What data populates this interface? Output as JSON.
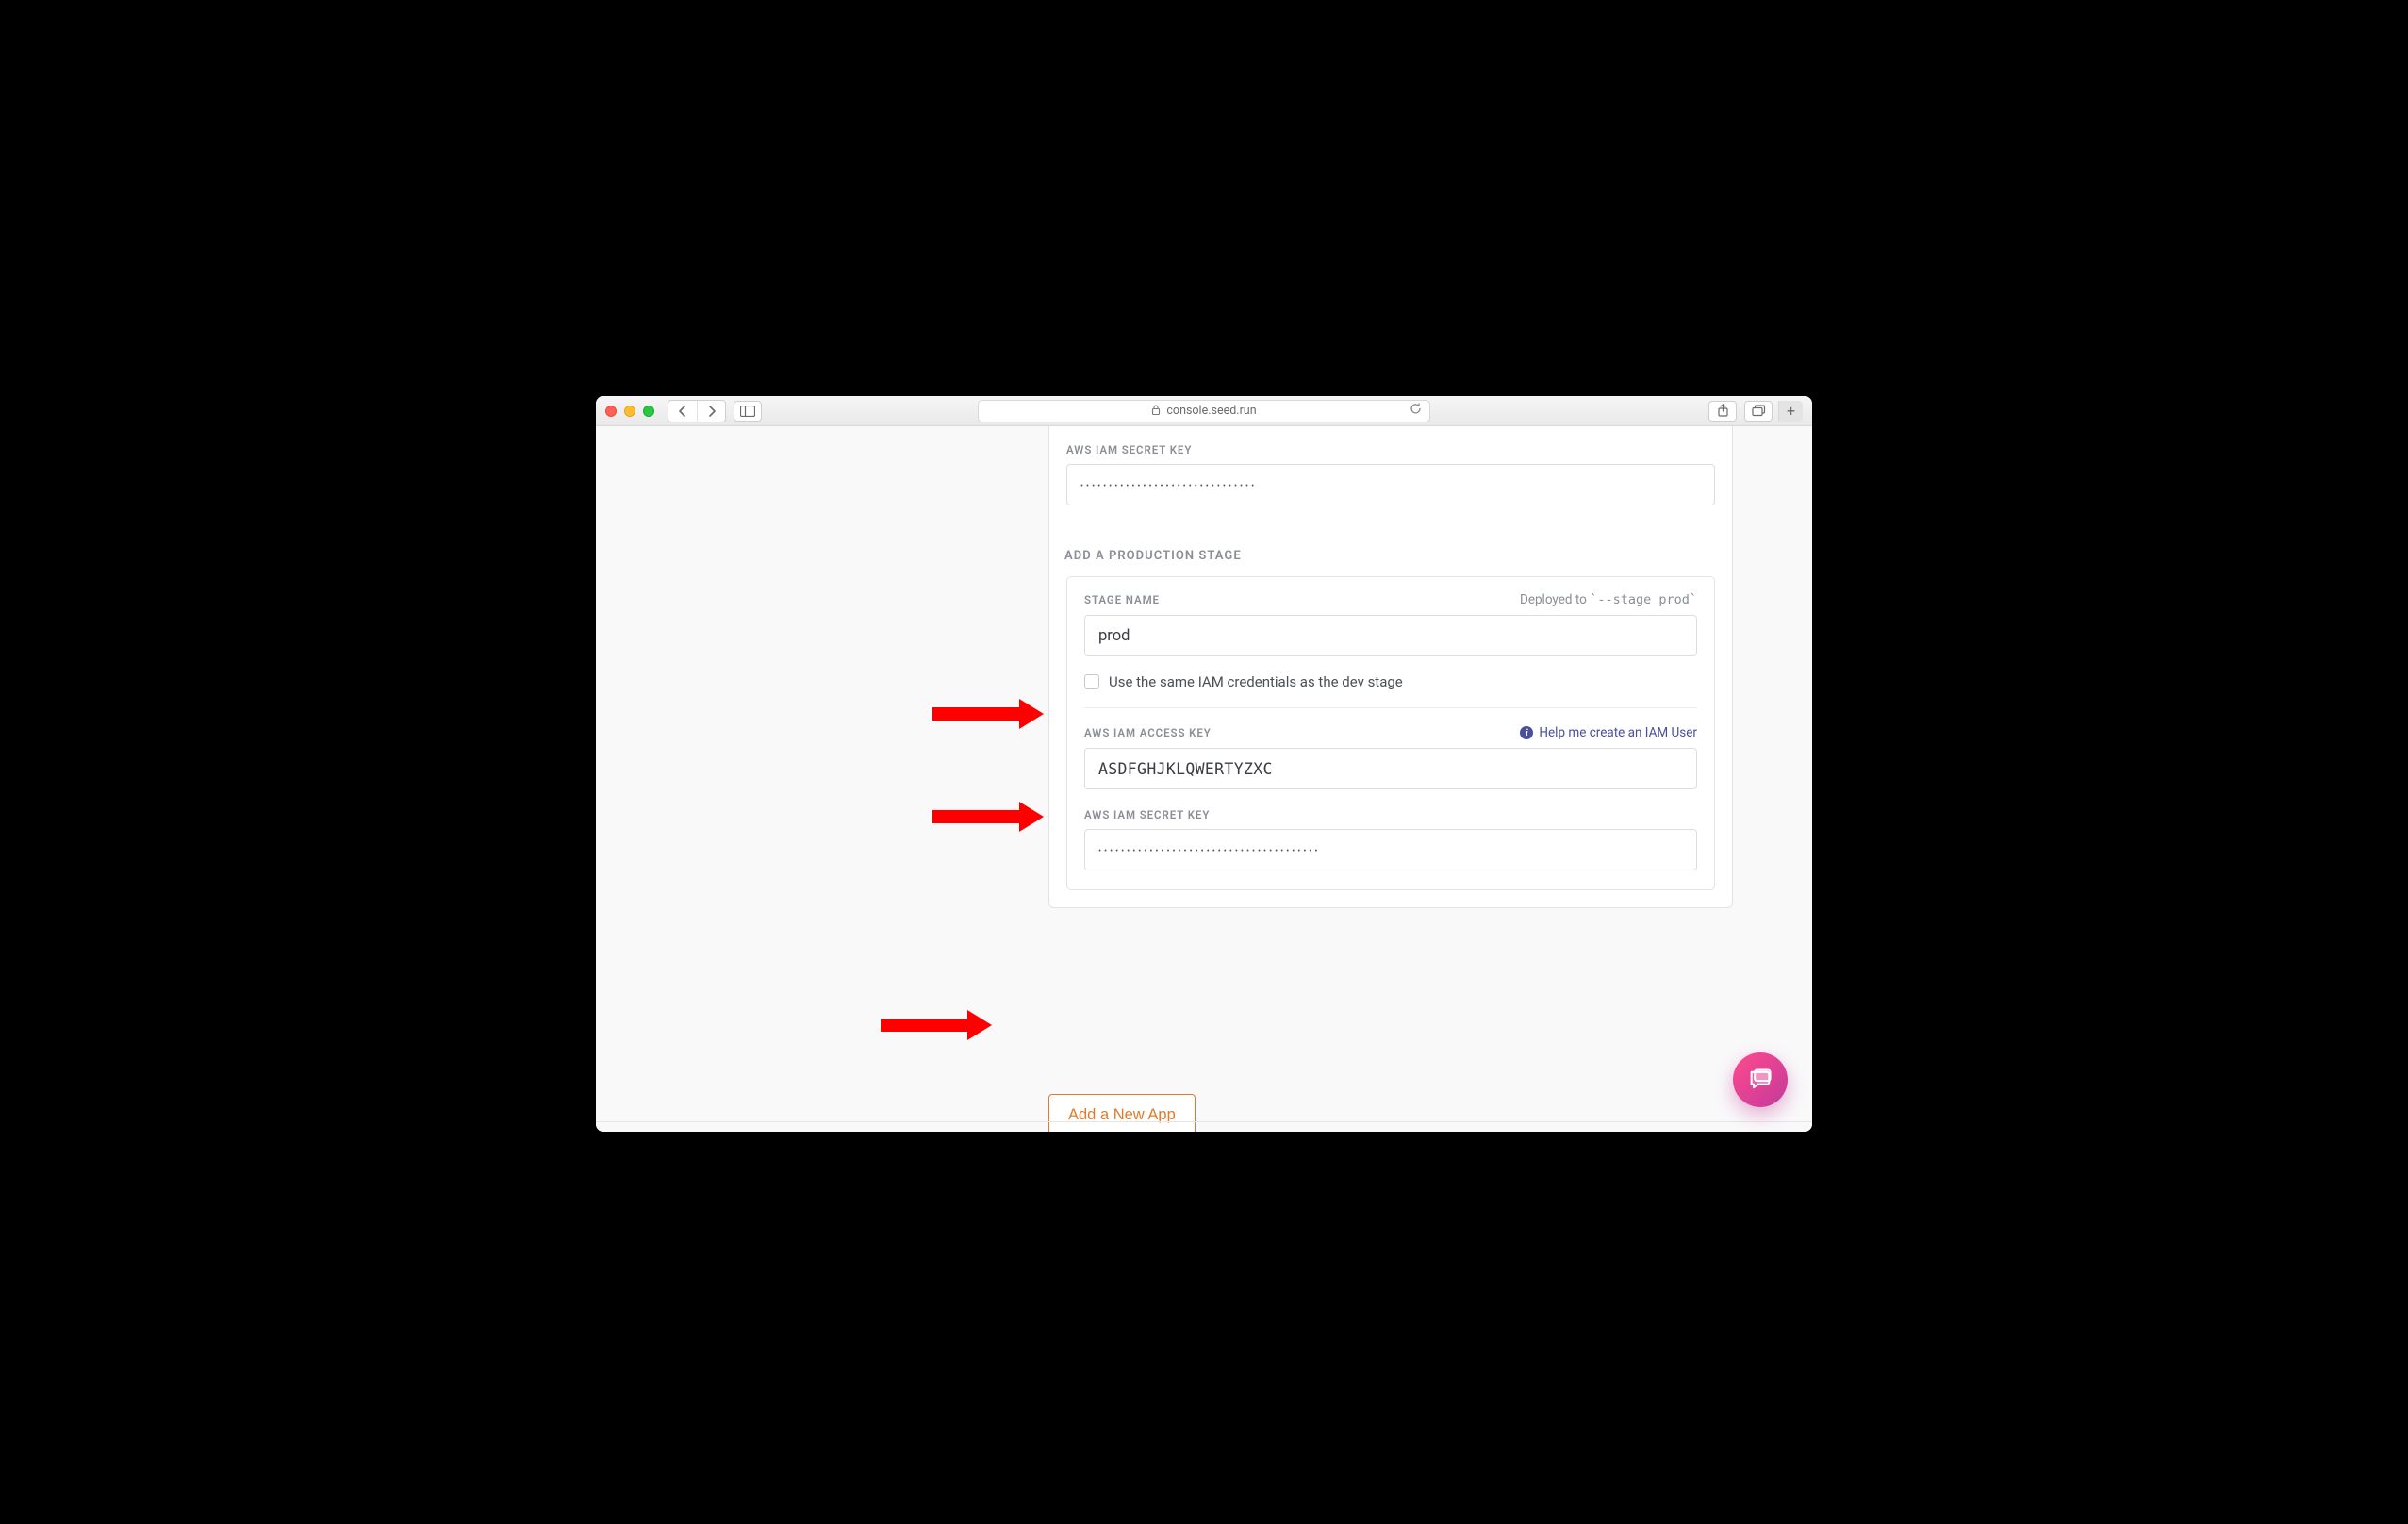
{
  "browser": {
    "url_host": "console.seed.run",
    "lock": "🔒"
  },
  "dev_stage": {
    "secret_label": "AWS IAM SECRET KEY",
    "secret_value": "•••••••••••••••••••••••••••••••"
  },
  "prod_section": {
    "header": "ADD A PRODUCTION STAGE",
    "stage_name_label": "STAGE NAME",
    "deployed_prefix": "Deployed to",
    "deployed_code": "`--stage prod`",
    "stage_name_value": "prod",
    "same_creds_label": "Use the same IAM credentials as the dev stage",
    "access_key_label": "AWS IAM ACCESS KEY",
    "help_text": "Help me create an IAM User",
    "access_key_value": "ASDFGHJKLQWERTYZXC",
    "secret_label": "AWS IAM SECRET KEY",
    "secret_value": "•••••••••••••••••••••••••••••••••••••••"
  },
  "submit": {
    "label": "Add a New App"
  }
}
